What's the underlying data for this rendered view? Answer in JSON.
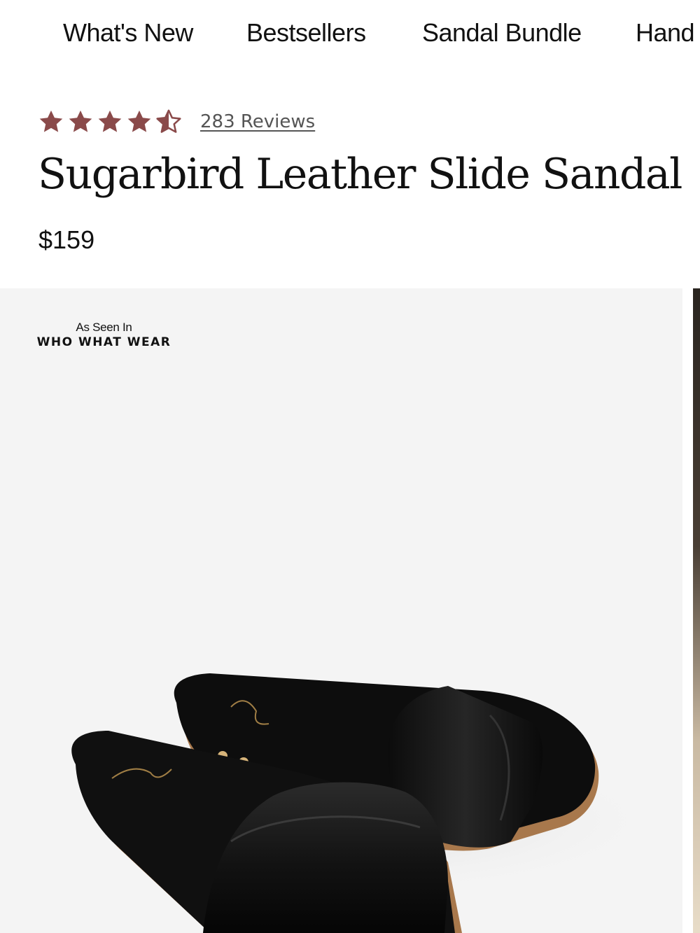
{
  "nav": {
    "items": [
      {
        "label": "What's New"
      },
      {
        "label": "Bestsellers"
      },
      {
        "label": "Sandal Bundle"
      },
      {
        "label": "Hand"
      }
    ]
  },
  "rating": {
    "value": 4.5,
    "max": 5,
    "reviews_label": "283 Reviews",
    "star_color": "#8a4a4a"
  },
  "product": {
    "title": "Sugarbird Leather Slide Sandal",
    "price": "$159"
  },
  "gallery": {
    "badge_kicker": "As Seen In",
    "badge_name": "WHO WHAT WEAR",
    "image_icon": "sandal-product-image"
  }
}
